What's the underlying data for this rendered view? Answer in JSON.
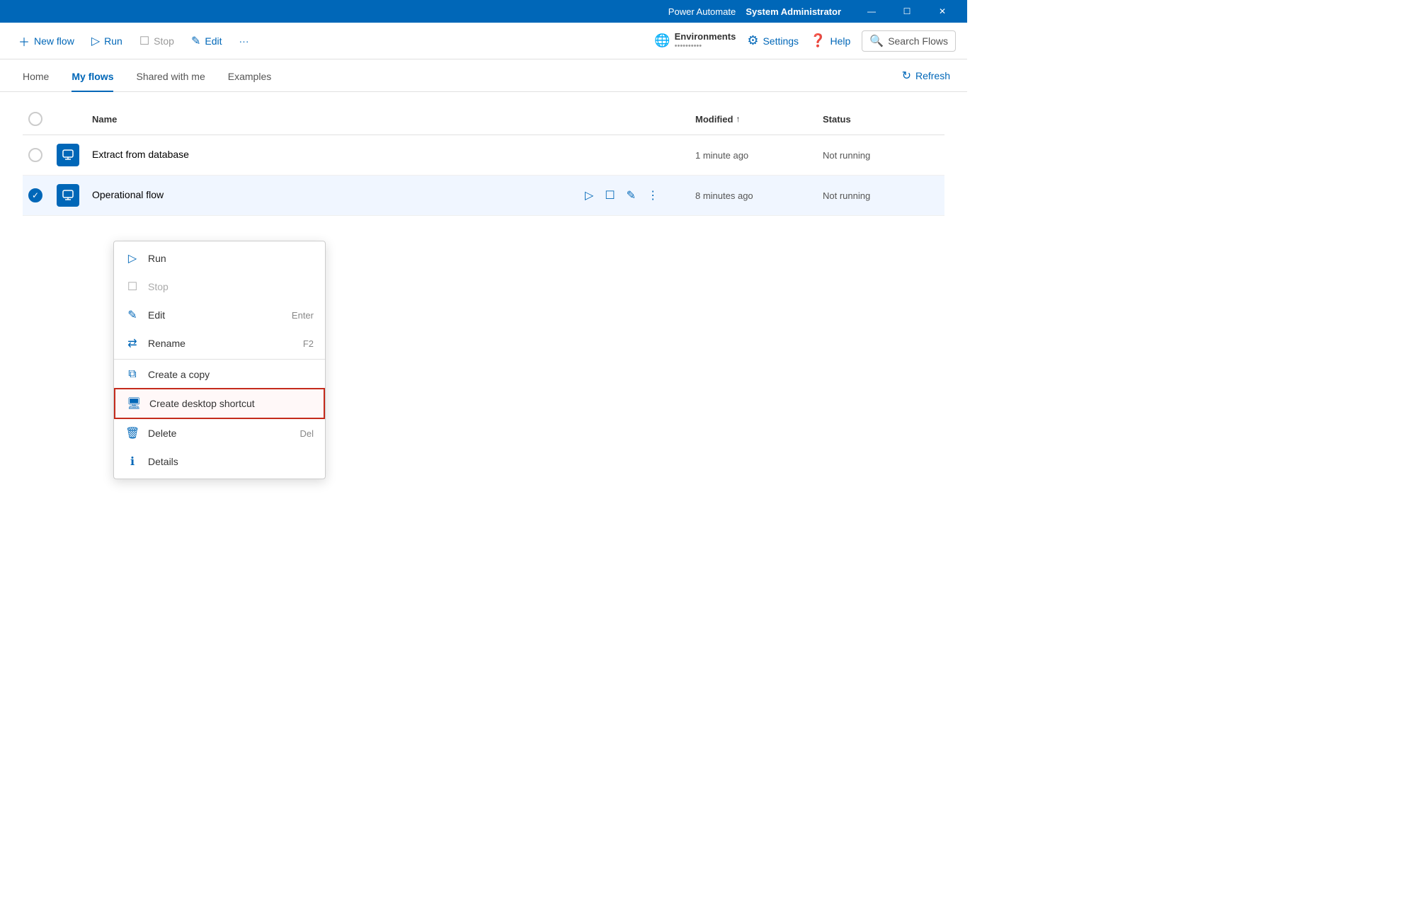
{
  "titleBar": {
    "title": "Power Automate",
    "user": "System Administrator",
    "minimizeLabel": "—",
    "maximizeLabel": "☐",
    "closeLabel": "✕"
  },
  "toolbar": {
    "newFlowLabel": "New flow",
    "runLabel": "Run",
    "stopLabel": "Stop",
    "editLabel": "Edit",
    "moreLabel": "···",
    "environmentsLabel": "Environments",
    "environmentValue": "••••••••••",
    "settingsLabel": "Settings",
    "helpLabel": "Help",
    "searchLabel": "Search Flows"
  },
  "tabs": [
    {
      "label": "Home",
      "active": false
    },
    {
      "label": "My flows",
      "active": true
    },
    {
      "label": "Shared with me",
      "active": false
    },
    {
      "label": "Examples",
      "active": false
    }
  ],
  "refreshLabel": "Refresh",
  "table": {
    "columns": {
      "name": "Name",
      "modified": "Modified",
      "status": "Status"
    },
    "rows": [
      {
        "id": 1,
        "name": "Extract from database",
        "modified": "1 minute ago",
        "status": "Not running",
        "selected": false
      },
      {
        "id": 2,
        "name": "Operational flow",
        "modified": "8 minutes ago",
        "status": "Not running",
        "selected": true
      }
    ]
  },
  "contextMenu": {
    "items": [
      {
        "label": "Run",
        "icon": "▷",
        "shortcut": "",
        "disabled": false,
        "highlighted": false
      },
      {
        "label": "Stop",
        "icon": "☐",
        "shortcut": "",
        "disabled": true,
        "highlighted": false
      },
      {
        "label": "Edit",
        "icon": "✎",
        "shortcut": "Enter",
        "disabled": false,
        "highlighted": false
      },
      {
        "label": "Rename",
        "icon": "⇄",
        "shortcut": "F2",
        "disabled": false,
        "highlighted": false
      },
      {
        "label": "Create a copy",
        "icon": "⧉",
        "shortcut": "",
        "disabled": false,
        "highlighted": false
      },
      {
        "label": "Create desktop shortcut",
        "icon": "🖥",
        "shortcut": "",
        "disabled": false,
        "highlighted": true
      },
      {
        "label": "Delete",
        "icon": "🗑",
        "shortcut": "Del",
        "disabled": false,
        "highlighted": false
      },
      {
        "label": "Details",
        "icon": "ℹ",
        "shortcut": "",
        "disabled": false,
        "highlighted": false
      }
    ]
  }
}
